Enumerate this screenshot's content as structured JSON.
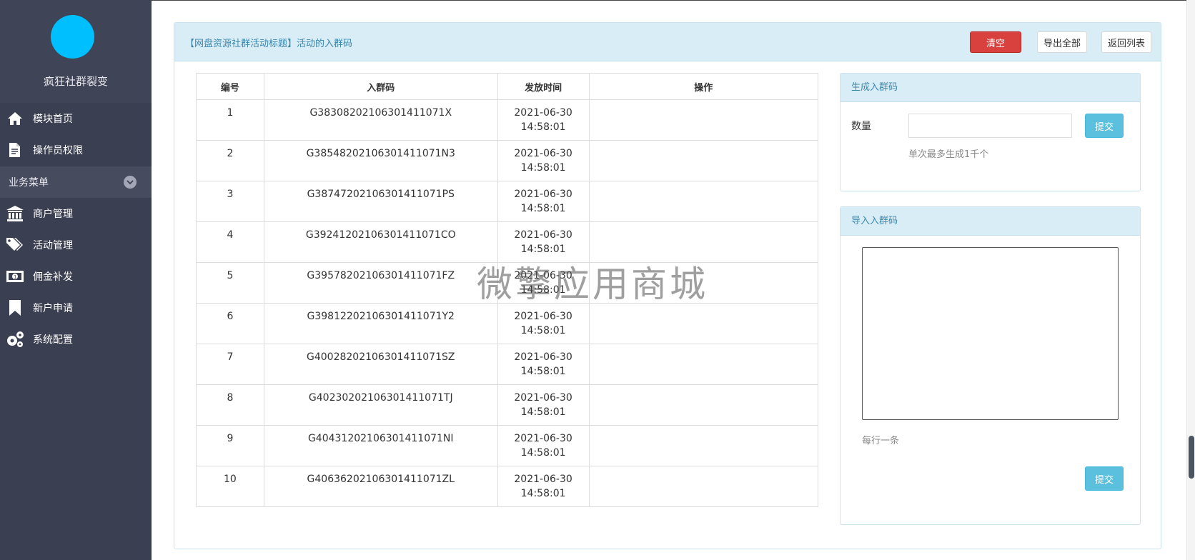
{
  "sidebar": {
    "brand": "疯狂社群裂变",
    "items_top": [
      {
        "label": "模块首页",
        "icon": "home-icon"
      },
      {
        "label": "操作员权限",
        "icon": "edit-document-icon"
      }
    ],
    "section_label": "业务菜单",
    "items_bottom": [
      {
        "label": "商户管理",
        "icon": "bank-icon"
      },
      {
        "label": "活动管理",
        "icon": "tags-icon"
      },
      {
        "label": "佣金补发",
        "icon": "money-icon"
      },
      {
        "label": "新户申请",
        "icon": "bookmark-icon"
      },
      {
        "label": "系统配置",
        "icon": "gears-icon"
      }
    ]
  },
  "header": {
    "title": "【网盘资源社群活动标题】活动的入群码",
    "clear_label": "清空",
    "export_label": "导出全部",
    "back_label": "返回列表"
  },
  "table": {
    "headers": [
      "编号",
      "入群码",
      "发放时间",
      "操作"
    ],
    "rows": [
      {
        "no": "1",
        "code": "G38308202106301411071X",
        "date": "2021-06-30",
        "time": "14:58:01"
      },
      {
        "no": "2",
        "code": "G38548202106301411071N3",
        "date": "2021-06-30",
        "time": "14:58:01"
      },
      {
        "no": "3",
        "code": "G38747202106301411071PS",
        "date": "2021-06-30",
        "time": "14:58:01"
      },
      {
        "no": "4",
        "code": "G39241202106301411071CO",
        "date": "2021-06-30",
        "time": "14:58:01"
      },
      {
        "no": "5",
        "code": "G39578202106301411071FZ",
        "date": "2021-06-30",
        "time": "14:58:01"
      },
      {
        "no": "6",
        "code": "G39812202106301411071Y2",
        "date": "2021-06-30",
        "time": "14:58:01"
      },
      {
        "no": "7",
        "code": "G40028202106301411071SZ",
        "date": "2021-06-30",
        "time": "14:58:01"
      },
      {
        "no": "8",
        "code": "G40230202106301411071TJ",
        "date": "2021-06-30",
        "time": "14:58:01"
      },
      {
        "no": "9",
        "code": "G40431202106301411071NI",
        "date": "2021-06-30",
        "time": "14:58:01"
      },
      {
        "no": "10",
        "code": "G40636202106301411071ZL",
        "date": "2021-06-30",
        "time": "14:58:01"
      }
    ]
  },
  "generate": {
    "title": "生成入群码",
    "qty_label": "数量",
    "qty_value": "",
    "submit_label": "提交",
    "hint": "单次最多生成1千个"
  },
  "import": {
    "title": "导入入群码",
    "textarea_value": "",
    "hint": "每行一条",
    "submit_label": "提交"
  },
  "watermark": "微擎应用商城",
  "colors": {
    "sidebar_bg": "#3a3f51",
    "avatar": "#00bfff",
    "panel_head": "#d9edf7",
    "danger": "#d9413e",
    "info": "#5bc0de"
  }
}
